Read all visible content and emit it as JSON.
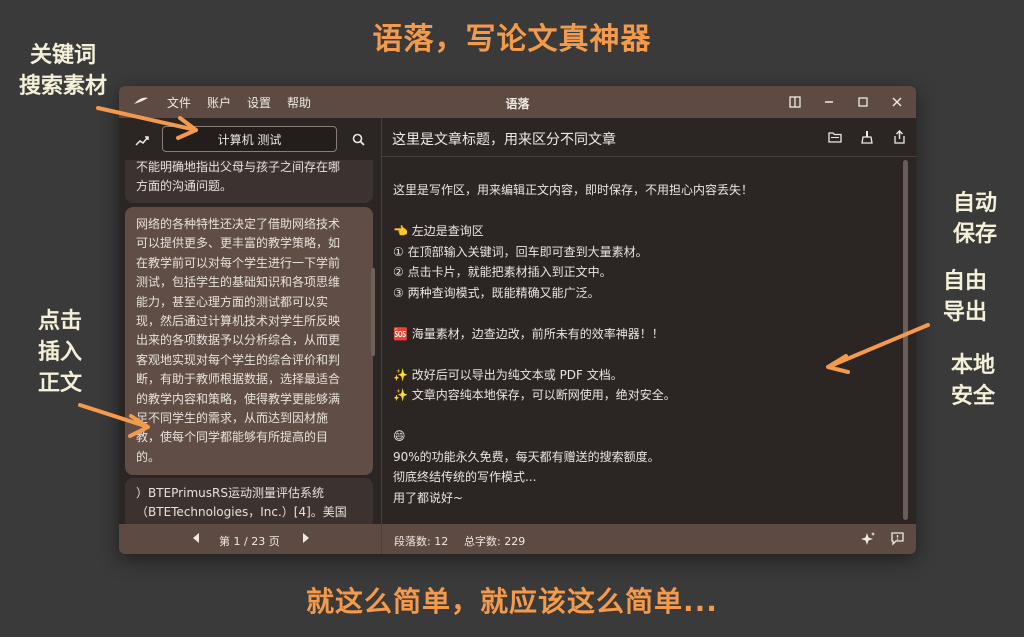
{
  "headline_top": "语落，写论文真神器",
  "headline_bottom": "就这么简单，就应该这么简单...",
  "callouts": {
    "search_line1": "关键词",
    "search_line2": "搜索素材",
    "insert_line1": "点击",
    "insert_line2": "插入",
    "insert_line3": "正文",
    "autosave_line1": "自动",
    "autosave_line2": "保存",
    "export_line1": "自由",
    "export_line2": "导出",
    "local_line1": "本地",
    "local_line2": "安全"
  },
  "window": {
    "app_title": "语落",
    "menu": [
      "文件",
      "账户",
      "设置",
      "帮助"
    ]
  },
  "left_panel": {
    "search_value": "计算机 测试",
    "cards": [
      "不能明确地指出父母与孩子之间存在哪\n方面的沟通问题。",
      "网络的各种特性还决定了借助网络技术\n可以提供更多、更丰富的教学策略，如\n在教学前可以对每个学生进行一下学前\n测试，包括学生的基础知识和各项思维\n能力，甚至心理方面的测试都可以实\n现，然后通过计算机技术对学生所反映\n出来的各项数据予以分析综合，从而更\n客观地实现对每个学生的综合评价和判\n断，有助于教师根据数据，选择最适合\n的教学内容和策略，使得教学更能够满\n足不同学生的需求，从而达到因材施\n教，使每个同学都能够有所提高的目\n的。",
      "）BTEPrimusRS运动测量评估系统\n（BTETechnologies，Inc.）[4]。美国"
    ],
    "page_label": "第 1 / 23 页"
  },
  "editor": {
    "doc_title": "这里是文章标题，用来区分不同文章",
    "content": "这里是写作区，用来编辑正文内容，即时保存，不用担心内容丢失！\n\n👈 左边是查询区\n① 在顶部输入关键词，回车即可查到大量素材。\n② 点击卡片，就能把素材插入到正文中。\n③ 两种查询模式，既能精确又能广泛。\n\n🆘 海量素材，边查边改，前所未有的效率神器！！\n\n✨ 改好后可以导出为纯文本或 PDF 文档。\n✨ 文章内容纯本地保存，可以断网使用，绝对安全。\n\n😄\n90%的功能永久免费，每天都有赠送的搜索额度。\n彻底终结传统的写作模式...\n用了都说好~",
    "paragraph_count": "段落数: 12",
    "word_count": "总字数: 229"
  },
  "colors": {
    "accent_orange": "#f39a4d",
    "titlebar": "#5c4a43",
    "card_highlight": "#5f4d46",
    "window_bg": "#2b2523"
  },
  "icons": [
    "logo-icon",
    "trend-icon",
    "search-icon",
    "layout-icon",
    "minimize-icon",
    "maximize-icon",
    "close-icon",
    "folder-icon",
    "clean-icon",
    "share-icon",
    "prev-page-icon",
    "next-page-icon",
    "ai-sparkle-icon",
    "feedback-icon"
  ]
}
